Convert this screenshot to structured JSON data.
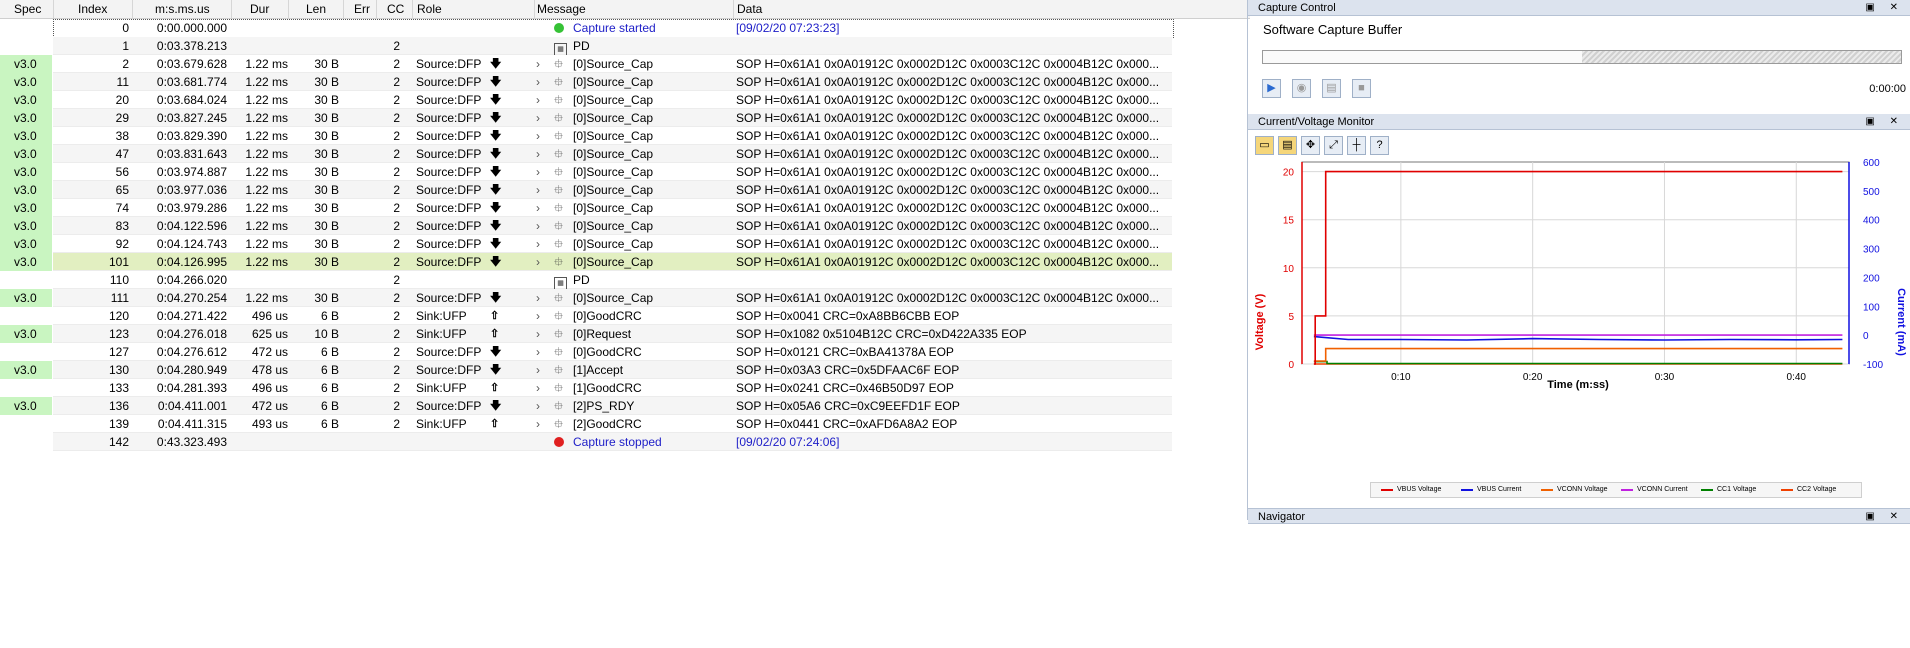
{
  "table": {
    "headers": {
      "spec": "Spec",
      "index": "Index",
      "time": "m:s.ms.us",
      "dur": "Dur",
      "len": "Len",
      "err": "Err",
      "cc": "CC",
      "role": "Role",
      "message": "Message",
      "data": "Data"
    },
    "rows": [
      {
        "spec": "",
        "index": "0",
        "time": "0:00.000.000",
        "dur": "",
        "len": "",
        "cc": "",
        "role": "",
        "arrow": "",
        "icon": "green-dot",
        "message": "Capture started",
        "data": "[09/02/20 07:23:23]",
        "style": "event"
      },
      {
        "spec": "",
        "index": "1",
        "time": "0:03.378.213",
        "dur": "",
        "len": "",
        "cc": "2",
        "role": "",
        "arrow": "",
        "icon": "pd",
        "message": "PD",
        "data": "",
        "style": "pd"
      },
      {
        "spec": "v3.0",
        "index": "2",
        "time": "0:03.679.628",
        "dur": "1.22 ms",
        "len": "30 B",
        "cc": "2",
        "role": "Source:DFP",
        "arrow": "down",
        "icon": "usb",
        "message": "[0]Source_Cap",
        "data": "SOP H=0x61A1 0x0A01912C 0x0002D12C 0x0003C12C 0x0004B12C 0x000...",
        "style": "msg"
      },
      {
        "spec": "v3.0",
        "index": "11",
        "time": "0:03.681.774",
        "dur": "1.22 ms",
        "len": "30 B",
        "cc": "2",
        "role": "Source:DFP",
        "arrow": "down",
        "icon": "usb",
        "message": "[0]Source_Cap",
        "data": "SOP H=0x61A1 0x0A01912C 0x0002D12C 0x0003C12C 0x0004B12C 0x000...",
        "style": "msg"
      },
      {
        "spec": "v3.0",
        "index": "20",
        "time": "0:03.684.024",
        "dur": "1.22 ms",
        "len": "30 B",
        "cc": "2",
        "role": "Source:DFP",
        "arrow": "down",
        "icon": "usb",
        "message": "[0]Source_Cap",
        "data": "SOP H=0x61A1 0x0A01912C 0x0002D12C 0x0003C12C 0x0004B12C 0x000...",
        "style": "msg"
      },
      {
        "spec": "v3.0",
        "index": "29",
        "time": "0:03.827.245",
        "dur": "1.22 ms",
        "len": "30 B",
        "cc": "2",
        "role": "Source:DFP",
        "arrow": "down",
        "icon": "usb",
        "message": "[0]Source_Cap",
        "data": "SOP H=0x61A1 0x0A01912C 0x0002D12C 0x0003C12C 0x0004B12C 0x000...",
        "style": "msg"
      },
      {
        "spec": "v3.0",
        "index": "38",
        "time": "0:03.829.390",
        "dur": "1.22 ms",
        "len": "30 B",
        "cc": "2",
        "role": "Source:DFP",
        "arrow": "down",
        "icon": "usb",
        "message": "[0]Source_Cap",
        "data": "SOP H=0x61A1 0x0A01912C 0x0002D12C 0x0003C12C 0x0004B12C 0x000...",
        "style": "msg"
      },
      {
        "spec": "v3.0",
        "index": "47",
        "time": "0:03.831.643",
        "dur": "1.22 ms",
        "len": "30 B",
        "cc": "2",
        "role": "Source:DFP",
        "arrow": "down",
        "icon": "usb",
        "message": "[0]Source_Cap",
        "data": "SOP H=0x61A1 0x0A01912C 0x0002D12C 0x0003C12C 0x0004B12C 0x000...",
        "style": "msg"
      },
      {
        "spec": "v3.0",
        "index": "56",
        "time": "0:03.974.887",
        "dur": "1.22 ms",
        "len": "30 B",
        "cc": "2",
        "role": "Source:DFP",
        "arrow": "down",
        "icon": "usb",
        "message": "[0]Source_Cap",
        "data": "SOP H=0x61A1 0x0A01912C 0x0002D12C 0x0003C12C 0x0004B12C 0x000...",
        "style": "msg"
      },
      {
        "spec": "v3.0",
        "index": "65",
        "time": "0:03.977.036",
        "dur": "1.22 ms",
        "len": "30 B",
        "cc": "2",
        "role": "Source:DFP",
        "arrow": "down",
        "icon": "usb",
        "message": "[0]Source_Cap",
        "data": "SOP H=0x61A1 0x0A01912C 0x0002D12C 0x0003C12C 0x0004B12C 0x000...",
        "style": "msg"
      },
      {
        "spec": "v3.0",
        "index": "74",
        "time": "0:03.979.286",
        "dur": "1.22 ms",
        "len": "30 B",
        "cc": "2",
        "role": "Source:DFP",
        "arrow": "down",
        "icon": "usb",
        "message": "[0]Source_Cap",
        "data": "SOP H=0x61A1 0x0A01912C 0x0002D12C 0x0003C12C 0x0004B12C 0x000...",
        "style": "msg"
      },
      {
        "spec": "v3.0",
        "index": "83",
        "time": "0:04.122.596",
        "dur": "1.22 ms",
        "len": "30 B",
        "cc": "2",
        "role": "Source:DFP",
        "arrow": "down",
        "icon": "usb",
        "message": "[0]Source_Cap",
        "data": "SOP H=0x61A1 0x0A01912C 0x0002D12C 0x0003C12C 0x0004B12C 0x000...",
        "style": "msg"
      },
      {
        "spec": "v3.0",
        "index": "92",
        "time": "0:04.124.743",
        "dur": "1.22 ms",
        "len": "30 B",
        "cc": "2",
        "role": "Source:DFP",
        "arrow": "down",
        "icon": "usb",
        "message": "[0]Source_Cap",
        "data": "SOP H=0x61A1 0x0A01912C 0x0002D12C 0x0003C12C 0x0004B12C 0x000...",
        "style": "msg"
      },
      {
        "spec": "v3.0",
        "index": "101",
        "time": "0:04.126.995",
        "dur": "1.22 ms",
        "len": "30 B",
        "cc": "2",
        "role": "Source:DFP",
        "arrow": "down",
        "icon": "usb",
        "message": "[0]Source_Cap",
        "data": "SOP H=0x61A1 0x0A01912C 0x0002D12C 0x0003C12C 0x0004B12C 0x000...",
        "style": "selected"
      },
      {
        "spec": "",
        "index": "110",
        "time": "0:04.266.020",
        "dur": "",
        "len": "",
        "cc": "2",
        "role": "",
        "arrow": "",
        "icon": "pd",
        "message": "PD",
        "data": "",
        "style": "pd"
      },
      {
        "spec": "v3.0",
        "index": "111",
        "time": "0:04.270.254",
        "dur": "1.22 ms",
        "len": "30 B",
        "cc": "2",
        "role": "Source:DFP",
        "arrow": "down",
        "icon": "usb",
        "message": "[0]Source_Cap",
        "data": "SOP H=0x61A1 0x0A01912C 0x0002D12C 0x0003C12C 0x0004B12C 0x000...",
        "style": "msg"
      },
      {
        "spec": "",
        "index": "120",
        "time": "0:04.271.422",
        "dur": "496 us",
        "len": "6 B",
        "cc": "2",
        "role": "Sink:UFP",
        "arrow": "up",
        "icon": "usb",
        "message": "[0]GoodCRC",
        "data": "SOP H=0x0041 CRC=0xA8BB6CBB EOP",
        "style": "msg"
      },
      {
        "spec": "v3.0",
        "index": "123",
        "time": "0:04.276.018",
        "dur": "625 us",
        "len": "10 B",
        "cc": "2",
        "role": "Sink:UFP",
        "arrow": "up",
        "icon": "usb",
        "message": "[0]Request",
        "data": "SOP H=0x1082 0x5104B12C CRC=0xD422A335 EOP",
        "style": "msg"
      },
      {
        "spec": "",
        "index": "127",
        "time": "0:04.276.612",
        "dur": "472 us",
        "len": "6 B",
        "cc": "2",
        "role": "Source:DFP",
        "arrow": "down",
        "icon": "usb",
        "message": "[0]GoodCRC",
        "data": "SOP H=0x0121 CRC=0xBA41378A EOP",
        "style": "msg"
      },
      {
        "spec": "v3.0",
        "index": "130",
        "time": "0:04.280.949",
        "dur": "478 us",
        "len": "6 B",
        "cc": "2",
        "role": "Source:DFP",
        "arrow": "down",
        "icon": "usb",
        "message": "[1]Accept",
        "data": "SOP H=0x03A3 CRC=0x5DFAAC6F EOP",
        "style": "msg"
      },
      {
        "spec": "",
        "index": "133",
        "time": "0:04.281.393",
        "dur": "496 us",
        "len": "6 B",
        "cc": "2",
        "role": "Sink:UFP",
        "arrow": "up",
        "icon": "usb",
        "message": "[1]GoodCRC",
        "data": "SOP H=0x0241 CRC=0x46B50D97 EOP",
        "style": "msg"
      },
      {
        "spec": "v3.0",
        "index": "136",
        "time": "0:04.411.001",
        "dur": "472 us",
        "len": "6 B",
        "cc": "2",
        "role": "Source:DFP",
        "arrow": "down",
        "icon": "usb",
        "message": "[2]PS_RDY",
        "data": "SOP H=0x05A6 CRC=0xC9EEFD1F EOP",
        "style": "msg"
      },
      {
        "spec": "",
        "index": "139",
        "time": "0:04.411.315",
        "dur": "493 us",
        "len": "6 B",
        "cc": "2",
        "role": "Sink:UFP",
        "arrow": "up",
        "icon": "usb",
        "message": "[2]GoodCRC",
        "data": "SOP H=0x0441 CRC=0xAFD6A8A2 EOP",
        "style": "msg"
      },
      {
        "spec": "",
        "index": "142",
        "time": "0:43.323.493",
        "dur": "",
        "len": "",
        "cc": "",
        "role": "",
        "arrow": "",
        "icon": "red-dot",
        "message": "Capture stopped",
        "data": "[09/02/20 07:24:06]",
        "style": "event"
      }
    ]
  },
  "capture_control": {
    "title": "Capture Control",
    "buffer_label": "Software Capture Buffer",
    "buffer_fill": 0.5,
    "time_readout": "0:00:00",
    "buttons": [
      "play-icon",
      "record-icon",
      "export-icon",
      "stop-icon"
    ]
  },
  "cv_monitor": {
    "title": "Current/Voltage Monitor",
    "toolbar": [
      "open-icon",
      "save-icon",
      "pan-icon",
      "zoom-fit-icon",
      "cursor-icon",
      "help-icon"
    ],
    "chart_data": {
      "type": "line",
      "xlabel": "Time (m:ss)",
      "ylabel": "Voltage (V)",
      "y2label": "Current (mA)",
      "xlim": [
        2.5,
        44
      ],
      "ylim": [
        0,
        21
      ],
      "y2lim": [
        -100,
        600
      ],
      "xticks": [
        {
          "v": 10,
          "label": "0:10"
        },
        {
          "v": 20,
          "label": "0:20"
        },
        {
          "v": 30,
          "label": "0:30"
        },
        {
          "v": 40,
          "label": "0:40"
        }
      ],
      "yticks": [
        0,
        5,
        10,
        15,
        20
      ],
      "y2ticks": [
        -100,
        0,
        100,
        200,
        300,
        400,
        500,
        600
      ],
      "grid": true,
      "series": [
        {
          "name": "VBUS Voltage",
          "axis": "left",
          "color": "#e00000",
          "x": [
            3.4,
            3.5,
            3.5,
            4.3,
            4.3,
            43.5
          ],
          "y": [
            0,
            0,
            5,
            5,
            20,
            20
          ]
        },
        {
          "name": "VBUS Current",
          "axis": "right",
          "color": "#1010e0",
          "x": [
            3.4,
            6,
            10,
            15,
            20,
            25,
            30,
            35,
            40,
            43.5
          ],
          "y": [
            -5,
            -15,
            -15,
            -17,
            -12,
            -15,
            -17,
            -15,
            -16,
            -15
          ]
        },
        {
          "name": "VCONN Voltage",
          "axis": "left",
          "color": "#f06000",
          "x": [
            3.4,
            4.3,
            4.3,
            43.5
          ],
          "y": [
            0.3,
            0.3,
            1.6,
            1.6
          ]
        },
        {
          "name": "VCONN Current",
          "axis": "right",
          "color": "#c020e0",
          "x": [
            3.4,
            43.5
          ],
          "y": [
            0,
            0
          ]
        },
        {
          "name": "CC1 Voltage",
          "axis": "left",
          "color": "#008000",
          "x": [
            3.4,
            4.4,
            4.4,
            43.5
          ],
          "y": [
            0.25,
            0.25,
            0.05,
            0.05
          ]
        },
        {
          "name": "CC2 Voltage",
          "axis": "left",
          "color": "#f04000",
          "x": [
            3.4,
            3.5,
            3.5,
            43.5
          ],
          "y": [
            0,
            0,
            0,
            0
          ]
        }
      ]
    }
  },
  "navigator": {
    "title": "Navigator"
  }
}
